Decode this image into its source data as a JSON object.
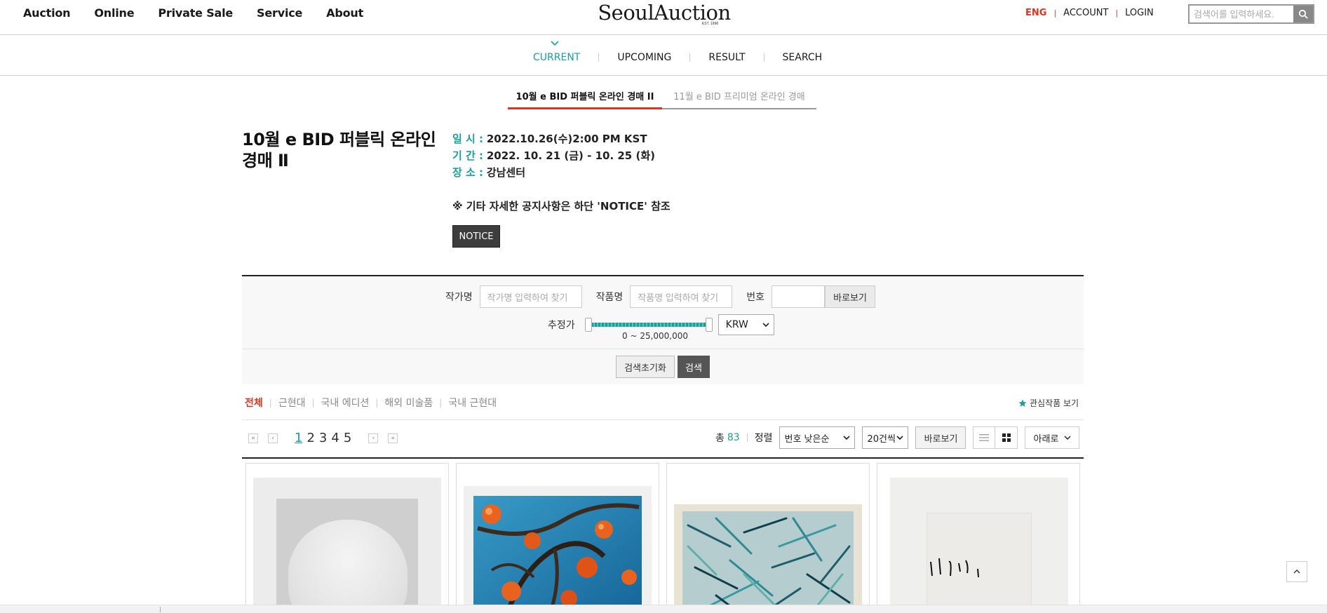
{
  "header": {
    "nav": [
      "Auction",
      "Online",
      "Private Sale",
      "Service",
      "About"
    ],
    "logo_text": "SeoulAuction",
    "logo_est": "EST. 1998",
    "lang": "ENG",
    "account": "ACCOUNT",
    "login": "LOGIN",
    "search_placeholder": "검색어를 입력하세요."
  },
  "subnav": {
    "items": [
      "CURRENT",
      "UPCOMING",
      "RESULT",
      "SEARCH"
    ],
    "active": "CURRENT"
  },
  "auction_tabs": [
    {
      "label": "10월 e BID 퍼블릭 온라인 경매 II",
      "active": true
    },
    {
      "label": "11월 e BID 프리미엄 온라인 경매",
      "active": false
    }
  ],
  "auction": {
    "title": "10월 e BID 퍼블릭 온라인 경매 Ⅱ",
    "date_label": "일 시 :",
    "date_value": "2022.10.26(수)2:00 PM KST",
    "period_label": "기 간 :",
    "period_value": "2022. 10. 21 (금) - 10. 25 (화)",
    "place_label": "장 소 :",
    "place_value": "강남센터",
    "note": "※ 기타 자세한 공지사항은 하단 'NOTICE' 참조",
    "notice_button": "NOTICE"
  },
  "search_panel": {
    "artist_label": "작가명",
    "artist_placeholder": "작가명 입력하여 찾기",
    "work_label": "작품명",
    "work_placeholder": "작품명 입력하여 찾기",
    "number_label": "번호",
    "goto_button": "바로보기",
    "estimate_label": "추정가",
    "range_text": "0 ~ 25,000,000",
    "currency": "KRW",
    "reset_button": "검색초기화",
    "search_button": "검색"
  },
  "categories": [
    {
      "label": "전체",
      "active": true
    },
    {
      "label": "근현대",
      "active": false
    },
    {
      "label": "국내 에디션",
      "active": false
    },
    {
      "label": "해외 미술품",
      "active": false
    },
    {
      "label": "국내 근현대",
      "active": false
    }
  ],
  "favorites_label": "관심작품 보기",
  "pagination": {
    "pages": [
      "1",
      "2",
      "3",
      "4",
      "5"
    ],
    "current": "1"
  },
  "toolbar": {
    "total_label": "총",
    "total_count": "83",
    "sort_label": "정렬",
    "sort_value": "번호 낮은순",
    "per_page_value": "20건씩",
    "goto_button": "바로보기",
    "down_button": "아래로"
  },
  "colors": {
    "accent_teal": "#1a9e9e",
    "accent_red": "#e0341f",
    "dark_button": "#3d3d3d"
  },
  "icons": {
    "search": "magnifier-icon",
    "favorite": "star-icon",
    "list_view": "list-icon",
    "grid_view": "grid-icon",
    "scroll_top": "chevron-up-icon"
  }
}
